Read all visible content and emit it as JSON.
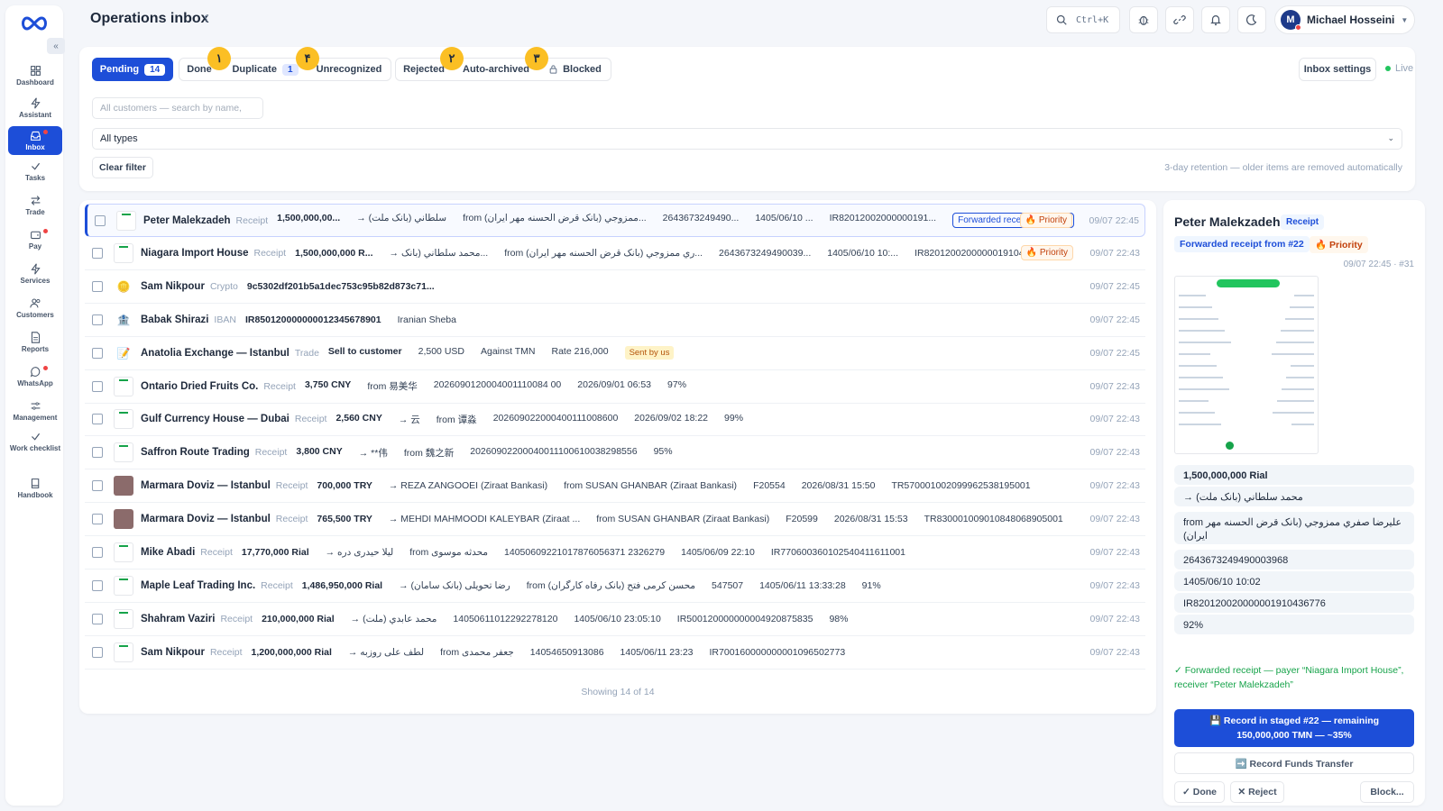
{
  "app": {
    "title": "Operations inbox",
    "help_glyph": "؟"
  },
  "colors": {
    "accent": "#1d4ed8",
    "priority": "#c2410c",
    "success": "#16a34a",
    "badge": "#fbbf24"
  },
  "sidebar": {
    "collapse": "«",
    "items": [
      {
        "label": "Dashboard",
        "icon": "grid-icon"
      },
      {
        "label": "Assistant",
        "icon": "bolt-icon"
      },
      {
        "label": "Inbox",
        "icon": "inbox-icon",
        "active": true
      },
      {
        "label": "Tasks",
        "icon": "check-icon"
      },
      {
        "label": "Trade",
        "icon": "swap-icon"
      },
      {
        "label": "Pay",
        "icon": "wallet-icon"
      },
      {
        "label": "Services",
        "icon": "bolt-icon"
      },
      {
        "label": "Customers",
        "icon": "users-icon"
      },
      {
        "label": "Reports",
        "icon": "report-icon"
      },
      {
        "label": "WhatsApp",
        "icon": "chat-icon"
      },
      {
        "label": "Management",
        "icon": "sliders-icon"
      },
      {
        "label": "Work checklist",
        "icon": "check-icon"
      },
      {
        "label": "Handbook",
        "icon": "book-icon"
      }
    ]
  },
  "topbar": {
    "shortcut": "Ctrl+K",
    "user": {
      "name": "Michael Hosseini",
      "initial": "M"
    },
    "icons": [
      "search-icon",
      "bug-icon",
      "link-icon",
      "bell-icon",
      "moon-icon"
    ]
  },
  "tabs": [
    {
      "label": "Pending",
      "count": "14",
      "active": true
    },
    {
      "label": "Done"
    },
    {
      "label": "Duplicate",
      "count": "1"
    },
    {
      "label": "Unrecognized"
    },
    {
      "label": "Rejected"
    },
    {
      "label": "Auto-archived"
    },
    {
      "label": "Blocked"
    }
  ],
  "badges": [
    "۱",
    "۴",
    "۲",
    "۳"
  ],
  "filters": {
    "inbox_settings": "Inbox settings",
    "live": "Live",
    "search_placeholder": "All customers — search by name,",
    "type_selected": "All types",
    "clear": "Clear filter",
    "retention": "3-day retention — older items are removed automatically"
  },
  "list": {
    "rows": [
      {
        "name": "Peter Malekzadeh",
        "type": "Receipt",
        "fields": [
          "1,500,000,00...",
          "→ سلطاني (بانک ملت)",
          "from ممزوجي (بانک قرض الحسنه مهر ایران)...",
          "2643673249490...",
          "1405/06/10 ...",
          "IR82012002000000191..."
        ],
        "forwarded": "Forwarded receipt from #22",
        "priority": "🔥 Priority",
        "time": "09/07 22:45",
        "thumb": "doc"
      },
      {
        "name": "Niagara Import House",
        "type": "Receipt",
        "fields": [
          "1,500,000,000 R...",
          "→ محمد سلطاني (بانک...",
          "from ري ممزوجي (بانک قرض الحسنه مهر ایران)...",
          "2643673249490039...",
          "1405/06/10 10:...",
          "IR820120020000001910436 7..."
        ],
        "priority": "🔥 Priority",
        "time": "09/07 22:43",
        "thumb": "doc"
      },
      {
        "name": "Sam Nikpour",
        "type": "Crypto",
        "fields": [
          "9c5302df201b5a1dec753c95b82d873c71..."
        ],
        "time": "09/07 22:45",
        "thumb": "coin"
      },
      {
        "name": "Babak Shirazi",
        "type": "IBAN",
        "fields": [
          "IR850120000000012345678901",
          "Iranian Sheba"
        ],
        "time": "09/07 22:45",
        "thumb": "bank"
      },
      {
        "name": "Anatolia Exchange — Istanbul",
        "type": "Trade",
        "fields": [
          "Sell to customer",
          "2,500 USD",
          "Against TMN",
          "Rate 216,000"
        ],
        "sent": "Sent by us",
        "time": "09/07 22:45",
        "thumb": "memo"
      },
      {
        "name": "Ontario Dried Fruits Co.",
        "type": "Receipt",
        "fields": [
          "3,750 CNY",
          "from 易美华",
          "2026090120004001110084 00",
          "2026/09/01 06:53",
          "97%"
        ],
        "time": "09/07 22:43",
        "thumb": "doc"
      },
      {
        "name": "Gulf Currency House — Dubai",
        "type": "Receipt",
        "fields": [
          "2,560 CNY",
          "→ 云",
          "from 谭淼",
          "202609022000400111008600",
          "2026/09/02 18:22",
          "99%"
        ],
        "time": "09/07 22:43",
        "thumb": "doc"
      },
      {
        "name": "Saffron Route Trading",
        "type": "Receipt",
        "fields": [
          "3,800 CNY",
          "→ **伟",
          "from 魏之新",
          "20260902200040011100610038298556",
          "95%"
        ],
        "time": "09/07 22:43",
        "thumb": "doc"
      },
      {
        "name": "Marmara Doviz — Istanbul",
        "type": "Receipt",
        "fields": [
          "700,000 TRY",
          "→ REZA ZANGOOEI (Ziraat Bankasi)",
          "from SUSAN GHANBAR (Ziraat Bankasi)",
          "F20554",
          "2026/08/31 15:50",
          "TR570001002099962538195001"
        ],
        "time": "09/07 22:43",
        "thumb": "dark"
      },
      {
        "name": "Marmara Doviz — Istanbul",
        "type": "Receipt",
        "fields": [
          "765,500 TRY",
          "→ MEHDI MAHMOODI KALEYBAR (Ziraat ...",
          "from SUSAN GHANBAR (Ziraat Bankasi)",
          "F20599",
          "2026/08/31 15:53",
          "TR830001009010848068905001"
        ],
        "time": "09/07 22:43",
        "thumb": "dark"
      },
      {
        "name": "Mike Abadi",
        "type": "Receipt",
        "fields": [
          "17,770,000 Rial",
          "→ لیلا حیدری دره",
          "from محدثه موسوی",
          "14050609221017876056371 2326279",
          "1405/06/09 22:10",
          "IR770600360102540411611001"
        ],
        "time": "09/07 22:43",
        "thumb": "doc"
      },
      {
        "name": "Maple Leaf Trading Inc.",
        "type": "Receipt",
        "fields": [
          "1,486,950,000 Rial",
          "→ رضا تحویلی (بانک سامان)",
          "from محسن کرمی فتح (بانک رفاه کارگران)",
          "547507",
          "1405/06/11 13:33:28",
          "91%"
        ],
        "time": "09/07 22:43",
        "thumb": "doc"
      },
      {
        "name": "Shahram Vaziri",
        "type": "Receipt",
        "fields": [
          "210,000,000 Rial",
          "→ محمد عابدي (ملت)",
          "14050611012292278120",
          "1405/06/10 23:05:10",
          "IR500120000000004920875835",
          "98%"
        ],
        "time": "09/07 22:43",
        "thumb": "doc"
      },
      {
        "name": "Sam Nikpour",
        "type": "Receipt",
        "fields": [
          "1,200,000,000 Rial",
          "→ لطف علی روزبه",
          "from جعفر محمدی",
          "14054650913086",
          "1405/06/11 23:23",
          "IR700160000000001096502773"
        ],
        "time": "09/07 22:43",
        "thumb": "doc"
      }
    ],
    "showing": "Showing 14 of 14"
  },
  "detail": {
    "name": "Peter Malekzadeh",
    "type": "Receipt",
    "forwarded": "Forwarded receipt from #22",
    "priority": "🔥 Priority",
    "time": "09/07 22:45 · #31",
    "fields": [
      "1,500,000,000 Rial",
      "→ محمد سلطاني (بانک ملت)",
      "from علیرضا صفري ممزوجي (بانک قرض الحسنه مهر ایران)",
      "2643673249490003968",
      "1405/06/10 10:02",
      "IR820120020000001910436776",
      "92%"
    ],
    "note": "✓ Forwarded receipt — payer “Niagara Import House”, receiver “Peter Malekzadeh”",
    "primary_action": "💾 Record in staged #22 — remaining 150,000,000 TMN — ~35%",
    "secondary_action": "➡️ Record Funds Transfer",
    "done": "✓ Done",
    "reject": "✕ Reject",
    "block": "Block..."
  }
}
